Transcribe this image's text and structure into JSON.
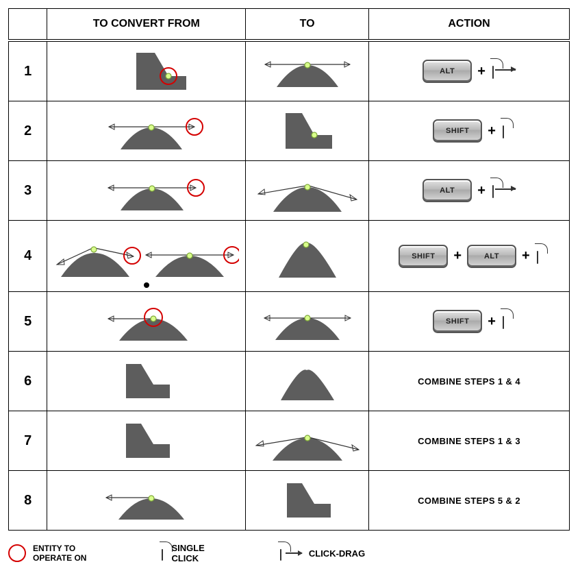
{
  "headers": {
    "from": "TO CONVERT FROM",
    "to": "TO",
    "action": "ACTION"
  },
  "rows": [
    {
      "num": "1",
      "action": {
        "type": "keys",
        "keys": [
          "ALT"
        ],
        "drag_arrow": true
      }
    },
    {
      "num": "2",
      "action": {
        "type": "keys",
        "keys": [
          "SHIFT"
        ],
        "drag_arrow": false
      }
    },
    {
      "num": "3",
      "action": {
        "type": "keys",
        "keys": [
          "ALT"
        ],
        "drag_arrow": true
      }
    },
    {
      "num": "4",
      "action": {
        "type": "keys",
        "keys": [
          "SHIFT",
          "ALT"
        ],
        "drag_arrow": false
      }
    },
    {
      "num": "5",
      "action": {
        "type": "keys",
        "keys": [
          "SHIFT"
        ],
        "drag_arrow": false
      }
    },
    {
      "num": "6",
      "action": {
        "type": "text",
        "text": "COMBINE STEPS 1 & 4"
      }
    },
    {
      "num": "7",
      "action": {
        "type": "text",
        "text": "COMBINE STEPS 1 & 3"
      }
    },
    {
      "num": "8",
      "action": {
        "type": "text",
        "text": "COMBINE STEPS 5 & 2"
      }
    }
  ],
  "plus": "+",
  "legend": {
    "entity": "ENTITY TO\nOPERATE ON",
    "single_click": "SINGLE\nCLICK",
    "click_drag": "CLICK-DRAG"
  },
  "colors": {
    "shape_fill": "#5d5d5d",
    "highlight_ring": "#d40000",
    "anchor_fill": "#d9ff8c",
    "anchor_stroke": "#7fa83a"
  }
}
